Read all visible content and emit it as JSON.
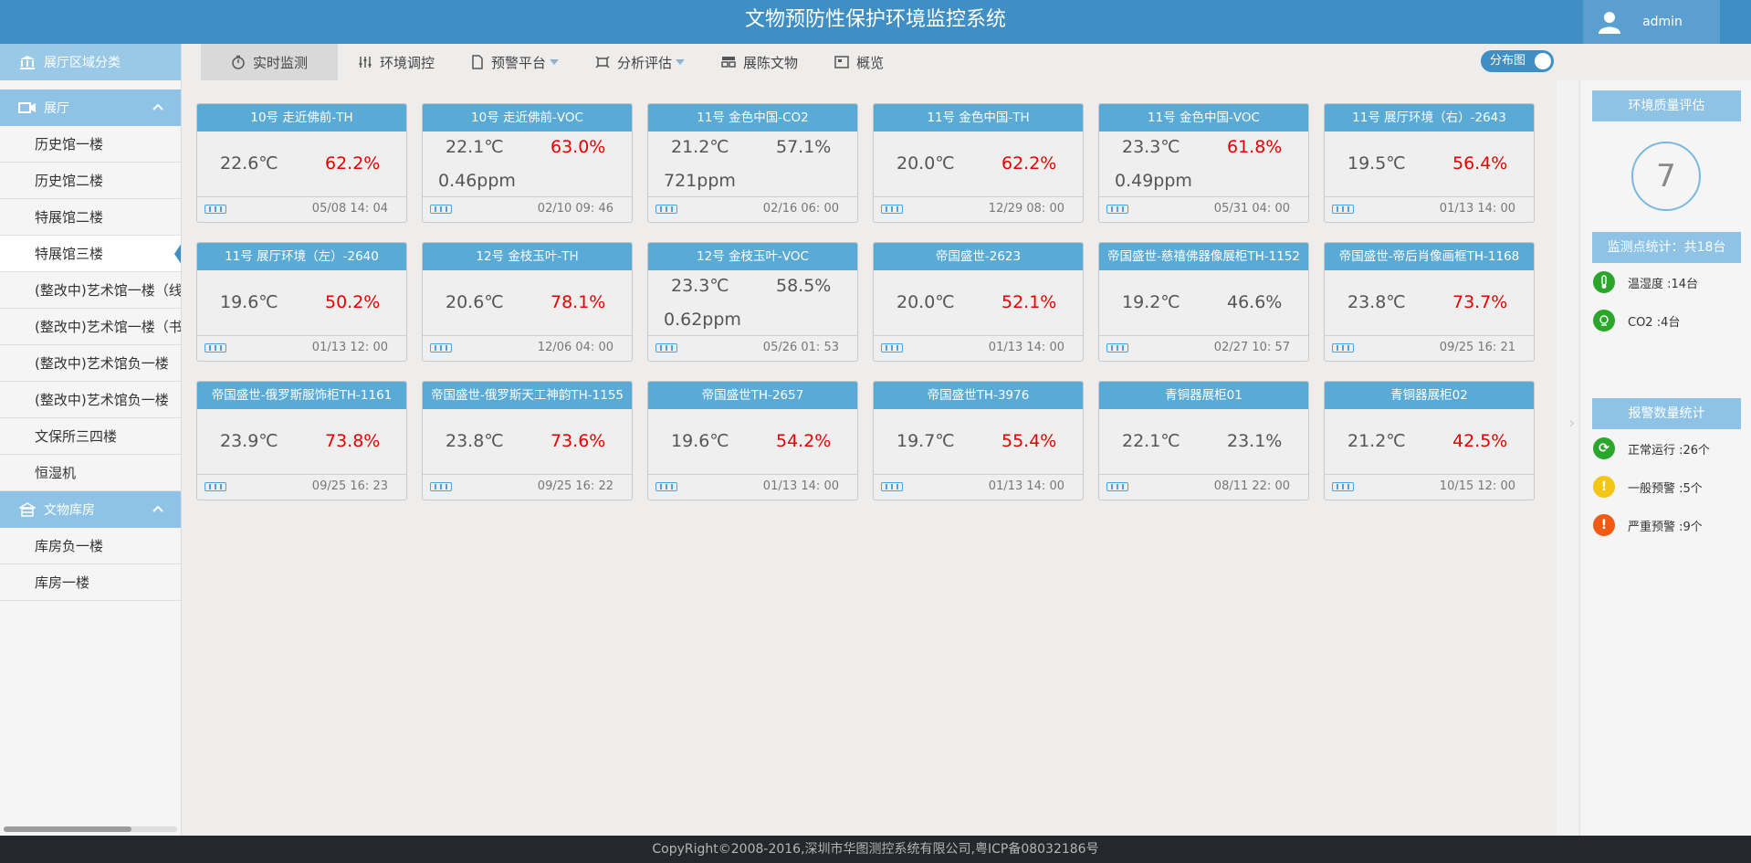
{
  "header": {
    "title": "文物预防性保护环境监控系统",
    "user": "admin"
  },
  "sidebar": {
    "region_title": "展厅区域分类",
    "groups": [
      {
        "title": "展厅",
        "items": [
          "历史馆一楼",
          "历史馆二楼",
          "特展馆二楼",
          "特展馆三楼",
          "(整改中)艺术馆一楼（线",
          "(整改中)艺术馆一楼（书",
          "(整改中)艺术馆负一楼",
          "(整改中)艺术馆负一楼",
          "文保所三四楼",
          "恒湿机"
        ]
      },
      {
        "title": "文物库房",
        "items": [
          "库房负一楼",
          "库房一楼"
        ]
      }
    ],
    "active_item": "特展馆三楼"
  },
  "nav": {
    "tabs": [
      {
        "label": "实时监测",
        "icon": "stopwatch-icon",
        "dropdown": false
      },
      {
        "label": "环境调控",
        "icon": "sliders-icon",
        "dropdown": false
      },
      {
        "label": "预警平台",
        "icon": "document-icon",
        "dropdown": true
      },
      {
        "label": "分析评估",
        "icon": "analysis-icon",
        "dropdown": true
      },
      {
        "label": "展陈文物",
        "icon": "exhibit-icon",
        "dropdown": false
      },
      {
        "label": "概览",
        "icon": "overview-icon",
        "dropdown": false
      }
    ],
    "toggle_label": "分布图"
  },
  "cards": [
    {
      "title": "10号 走近佛前-TH",
      "temp": "22.6℃",
      "hum": "62.2%",
      "hum_alarm": true,
      "extra": "",
      "time": "05/08 14: 04"
    },
    {
      "title": "10号 走近佛前-VOC",
      "temp": "22.1℃",
      "hum": "63.0%",
      "hum_alarm": true,
      "extra": "0.46ppm",
      "time": "02/10 09: 46"
    },
    {
      "title": "11号 金色中国-CO2",
      "temp": "21.2℃",
      "hum": "57.1%",
      "hum_alarm": false,
      "extra": "721ppm",
      "time": "02/16 06: 00"
    },
    {
      "title": "11号 金色中国-TH",
      "temp": "20.0℃",
      "hum": "62.2%",
      "hum_alarm": true,
      "extra": "",
      "time": "12/29 08: 00"
    },
    {
      "title": "11号 金色中国-VOC",
      "temp": "23.3℃",
      "hum": "61.8%",
      "hum_alarm": true,
      "extra": "0.49ppm",
      "time": "05/31 04: 00"
    },
    {
      "title": "11号 展厅环境（右）-2643",
      "temp": "19.5℃",
      "hum": "56.4%",
      "hum_alarm": true,
      "extra": "",
      "time": "01/13 14: 00"
    },
    {
      "title": "11号 展厅环境（左）-2640",
      "temp": "19.6℃",
      "hum": "50.2%",
      "hum_alarm": true,
      "extra": "",
      "time": "01/13 12: 00"
    },
    {
      "title": "12号 金枝玉叶-TH",
      "temp": "20.6℃",
      "hum": "78.1%",
      "hum_alarm": true,
      "extra": "",
      "time": "12/06 04: 00"
    },
    {
      "title": "12号 金枝玉叶-VOC",
      "temp": "23.3℃",
      "hum": "58.5%",
      "hum_alarm": false,
      "extra": "0.62ppm",
      "time": "05/26 01: 53"
    },
    {
      "title": "帝国盛世-2623",
      "temp": "20.0℃",
      "hum": "52.1%",
      "hum_alarm": true,
      "extra": "",
      "time": "01/13 14: 00"
    },
    {
      "title": "帝国盛世-慈禧佛器像展柜TH-1152",
      "temp": "19.2℃",
      "hum": "46.6%",
      "hum_alarm": false,
      "extra": "",
      "time": "02/27 10: 57"
    },
    {
      "title": "帝国盛世-帝后肖像画框TH-1168",
      "temp": "23.8℃",
      "hum": "73.7%",
      "hum_alarm": true,
      "extra": "",
      "time": "09/25 16: 21"
    },
    {
      "title": "帝国盛世-俄罗斯服饰柜TH-1161",
      "temp": "23.9℃",
      "hum": "73.8%",
      "hum_alarm": true,
      "extra": "",
      "time": "09/25 16: 23"
    },
    {
      "title": "帝国盛世-俄罗斯天工神韵TH-1155",
      "temp": "23.8℃",
      "hum": "73.6%",
      "hum_alarm": true,
      "extra": "",
      "time": "09/25 16: 22"
    },
    {
      "title": "帝国盛世TH-2657",
      "temp": "19.6℃",
      "hum": "54.2%",
      "hum_alarm": true,
      "extra": "",
      "time": "01/13 14: 00"
    },
    {
      "title": "帝国盛世TH-3976",
      "temp": "19.7℃",
      "hum": "55.4%",
      "hum_alarm": true,
      "extra": "",
      "time": "01/13 14: 00"
    },
    {
      "title": "青铜器展柜01",
      "temp": "22.1℃",
      "hum": "23.1%",
      "hum_alarm": false,
      "extra": "",
      "time": "08/11 22: 00"
    },
    {
      "title": "青铜器展柜02",
      "temp": "21.2℃",
      "hum": "42.5%",
      "hum_alarm": true,
      "extra": "",
      "time": "10/15 12: 00"
    }
  ],
  "right_panel": {
    "quality_title": "环境质量评估",
    "score": "7",
    "points_title": "监测点统计：共18台",
    "points": [
      {
        "label": "温湿度 :14台",
        "icon": "thermometer-icon",
        "color": "#2aa62a"
      },
      {
        "label": "CO2 :4台",
        "icon": "co2-icon",
        "color": "#2aa62a"
      }
    ],
    "alarm_title": "报警数量统计",
    "alarms": [
      {
        "label": "正常运行 :26个",
        "icon": "refresh-icon",
        "color": "#2aa62a",
        "glyph": "⟳"
      },
      {
        "label": "一般预警 :5个",
        "icon": "warning-icon",
        "color": "#f3c614",
        "glyph": "!"
      },
      {
        "label": "严重预警 :9个",
        "icon": "alert-icon",
        "color": "#f05a14",
        "glyph": "!"
      }
    ]
  },
  "footer": {
    "text": "CopyRight©2008-2016,深圳市华图测控系统有限公司,粤ICP备08032186号"
  },
  "colors": {
    "header": "#3f8fc4",
    "card_head": "#5aaad6",
    "alarm_red": "#e60000",
    "sidebar_blue": "#8ec3e6"
  }
}
